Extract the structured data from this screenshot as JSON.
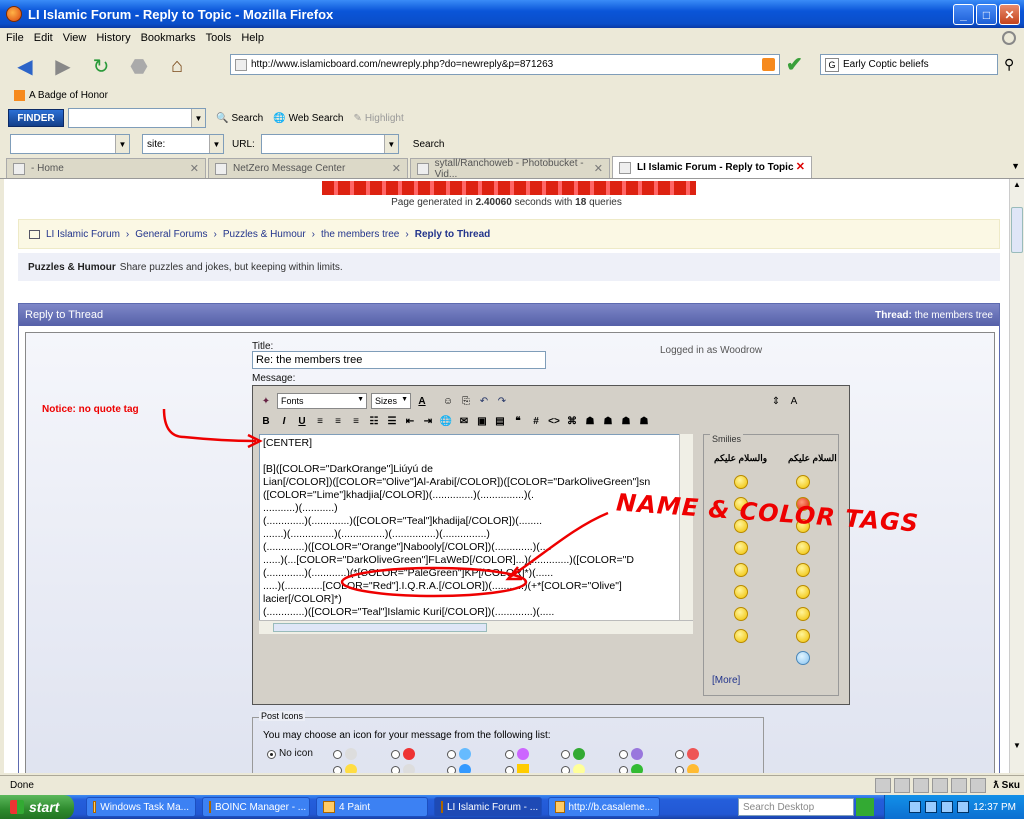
{
  "window": {
    "title": "LI Islamic Forum - Reply to Topic - Mozilla Firefox"
  },
  "menu": [
    "File",
    "Edit",
    "View",
    "History",
    "Bookmarks",
    "Tools",
    "Help"
  ],
  "nav": {
    "url": "http://www.islamicboard.com/newreply.php?do=newreply&p=871263",
    "search_value": "Early Coptic beliefs"
  },
  "bookmarks": [
    {
      "label": "A Badge of Honor"
    }
  ],
  "finder": {
    "logo": "FINDER",
    "search": "Search",
    "web_search": "Web Search",
    "highlight": "Highlight",
    "site_label": "site:",
    "url_label": "URL:",
    "search_btn": "Search"
  },
  "tabs": [
    {
      "label": "- Home"
    },
    {
      "label": "NetZero Message Center"
    },
    {
      "label": "sytall/Ranchoweb - Photobucket - Vid..."
    },
    {
      "label": "LI Islamic Forum - Reply to Topic"
    }
  ],
  "page": {
    "generated_pre": "Page generated in",
    "generated_secs": "2.40060",
    "generated_mid": "seconds with",
    "generated_queries": "18",
    "generated_post": "queries",
    "breadcrumb": [
      "LI Islamic Forum",
      "General Forums",
      "Puzzles & Humour",
      "the members tree"
    ],
    "breadcrumb_current": "Reply to Thread",
    "forum_name": "Puzzles & Humour",
    "forum_desc": "Share puzzles and jokes, but keeping within limits.",
    "reply_header": "Reply to Thread",
    "thread_label": "Thread:",
    "thread_name": "the members tree",
    "title_label": "Title:",
    "title_value": "Re: the members tree",
    "logged_label": "Logged in as",
    "logged_user": "Woodrow",
    "message_label": "Message:",
    "fonts": "Fonts",
    "sizes": "Sizes",
    "smilies_caption": "Smilies",
    "arabic_1": "والسلام عليكم",
    "arabic_2": "السلام عليكم",
    "more": "[More]",
    "post_icons_caption": "Post Icons",
    "post_icons_msg": "You may choose an icon for your message from the following list:",
    "no_icon": "No icon"
  },
  "message_lines": [
    "[CENTER]",
    "",
    "[B]([COLOR=\"DarkOrange\"]Liúyú de",
    "Lian[/COLOR])([COLOR=\"Olive\"]Al-Arabi[/COLOR])([COLOR=\"DarkOliveGreen\"]sn",
    "([COLOR=\"Lime\"]khadjia[/COLOR])(..............)(...............)(.",
    "...........)(...........)",
    "(.............)(.............)([COLOR=\"Teal\"]khadija[/COLOR])(........",
    ".......)(...............)(...............)(...............)(...............)",
    "(.............)([COLOR=\"Orange\"]Nabooly[/COLOR])(.............)(....",
    "......)(...[COLOR=\"DarkOliveGreen\"]FLaWeD[/COLOR]...)(.............)([COLOR=\"D",
    "(.............)(............)(*[COLOR=\"PaleGreen\"]KP[/COLOR]*)(......",
    ".....)(.............[COLOR=\"Red\"].I.Q.R.A.[/COLOR])(...........)(+*[COLOR=\"Olive\"]",
    "lacier[/COLOR]*)",
    "(.............)([COLOR=\"Teal\"]Islamic Kuri[/COLOR])(.............)(.....",
    "......)(.............)(.............)(.............)(.............)"
  ],
  "annotations": {
    "notice": "Notice: no quote tag",
    "name_color": "NAME & COLOR TAGS"
  },
  "status": {
    "text": "Done",
    "locale": "ƛ Sĸu"
  },
  "taskbar": {
    "start": "start",
    "tasks": [
      "Windows Task Ma...",
      "BOINC Manager - ...",
      "4 Paint",
      "LI Islamic Forum - ...",
      "http://b.casaleme..."
    ],
    "desktop_search": "Search Desktop",
    "clock": "12:37 PM"
  },
  "colors": {
    "xp_blue": "#0a55d8",
    "forum_header": "#5560a8",
    "annotation_red": "#e00000"
  }
}
